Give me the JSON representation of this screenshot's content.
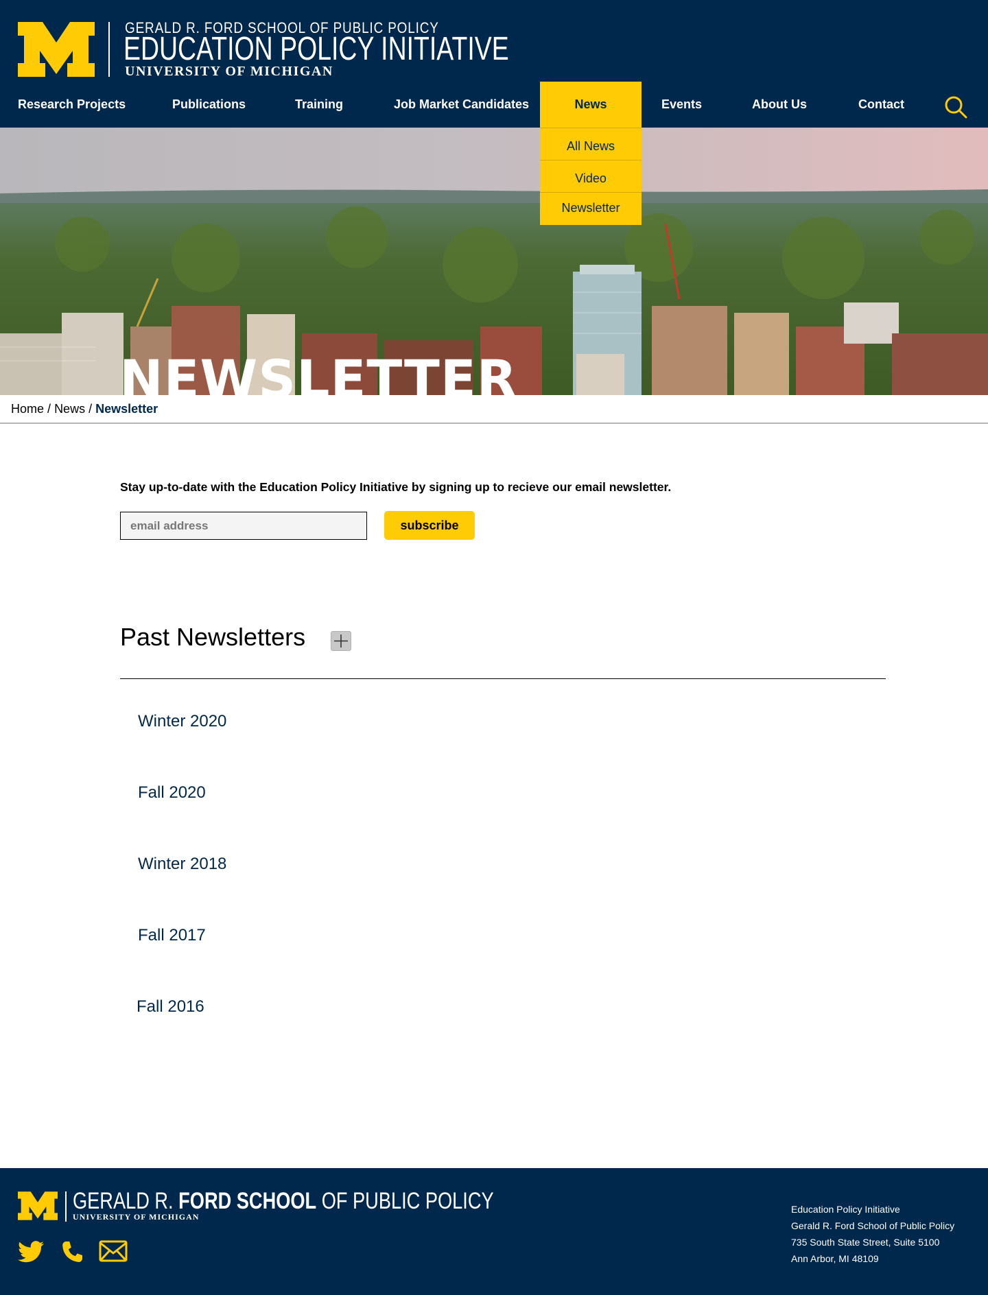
{
  "header": {
    "logo_line1": "GERALD R. FORD SCHOOL OF PUBLIC POLICY",
    "logo_line2": "EDUCATION POLICY INITIATIVE",
    "logo_line3": "UNIVERSITY OF MICHIGAN"
  },
  "nav": {
    "items": [
      {
        "label": "Research Projects"
      },
      {
        "label": "Publications"
      },
      {
        "label": "Training"
      },
      {
        "label": "Job Market Candidates"
      },
      {
        "label": "News"
      },
      {
        "label": "Events"
      },
      {
        "label": "About Us"
      },
      {
        "label": "Contact"
      }
    ],
    "dropdown": [
      {
        "label": "All News"
      },
      {
        "label": "Video"
      },
      {
        "label": "Newsletter"
      }
    ]
  },
  "hero": {
    "title": "NEWSLETTER"
  },
  "breadcrumb": {
    "home": "Home",
    "news": "News",
    "current": "Newsletter",
    "separator": "/"
  },
  "subscribe": {
    "intro": "Stay up-to-date with the Education Policy Initiative by signing up to recieve our email newsletter.",
    "placeholder": "email address",
    "button": "subscribe"
  },
  "past": {
    "title": "Past Newsletters",
    "items": [
      {
        "label": "Winter 2020"
      },
      {
        "label": "Fall 2020"
      },
      {
        "label": "Winter 2018"
      },
      {
        "label": "Fall 2017"
      },
      {
        "label": "Fall 2016"
      }
    ]
  },
  "footer": {
    "logo_light1": "GERALD R. ",
    "logo_bold": "FORD SCHOOL",
    "logo_light2": " OF PUBLIC POLICY",
    "logo_um": "UNIVERSITY OF MICHIGAN",
    "address": [
      "Education Policy Initiative",
      "Gerald R. Ford School of Public Policy",
      "735 South State Street, Suite 5100",
      "Ann Arbor, MI 48109"
    ]
  },
  "colors": {
    "navy": "#00274c",
    "maize": "#ffcb05"
  }
}
